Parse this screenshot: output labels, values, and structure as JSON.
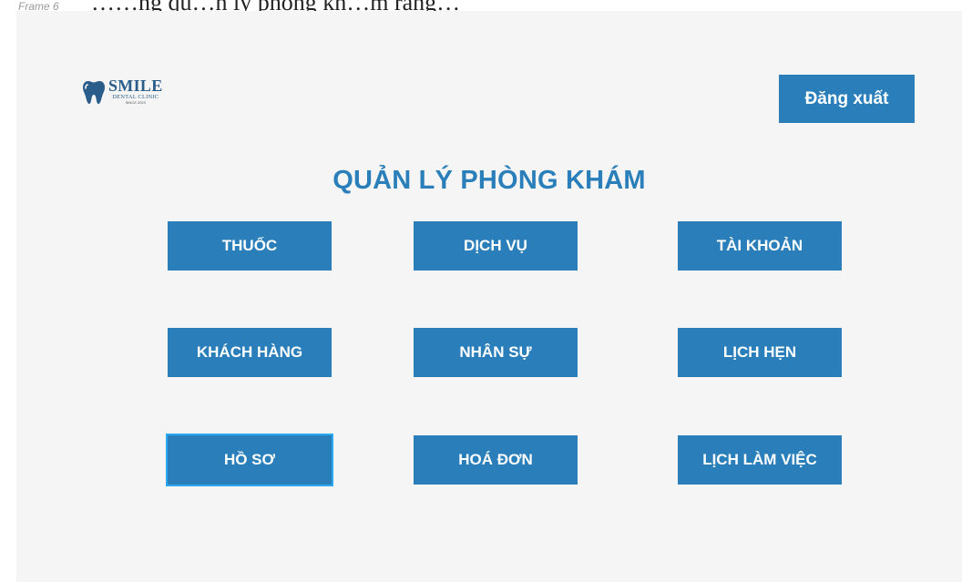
{
  "doc_text": "……ng qu…n lý phòng kh…m răng…",
  "frame_label": "Frame 6",
  "logo": {
    "name": "SMILE",
    "subtitle": "DENTAL CLINIC",
    "since": "SINCE 2023",
    "icon": "tooth-icon"
  },
  "header": {
    "logout_label": "Đăng xuất"
  },
  "page_title": "QUẢN LÝ PHÒNG KHÁM",
  "menu": [
    {
      "label": "THUỐC"
    },
    {
      "label": "DỊCH VỤ"
    },
    {
      "label": "TÀI KHOẢN"
    },
    {
      "label": "KHÁCH HÀNG"
    },
    {
      "label": "NHÂN SỰ"
    },
    {
      "label": "LỊCH HẸN"
    },
    {
      "label": "HỒ SƠ",
      "focused": true
    },
    {
      "label": "HOÁ ĐƠN"
    },
    {
      "label": "LỊCH LÀM VIỆC"
    }
  ],
  "colors": {
    "primary": "#2a7fba",
    "focus_outline": "#2aa8f0",
    "logo": "#2a5d8a",
    "canvas": "#f5f5f5"
  }
}
